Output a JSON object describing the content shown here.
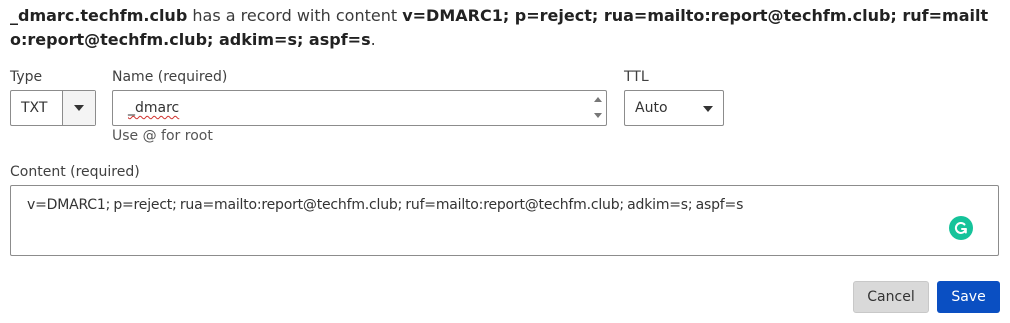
{
  "summary": {
    "record_name": "_dmarc.techfm.club",
    "middle_text": " has a record with content ",
    "record_content": "v=DMARC1; p=reject; rua=mailto:report@techfm.club; ruf=mailto:report@techfm.club; adkim=s; aspf=s",
    "end_punct": "."
  },
  "form": {
    "type_label": "Type",
    "type_value": "TXT",
    "name_label": "Name (required)",
    "name_value": "_dmarc",
    "name_helper": "Use @ for root",
    "ttl_label": "TTL",
    "ttl_value": "Auto",
    "content_label": "Content (required)",
    "content_value": "v=DMARC1; p=reject; rua=mailto:report@techfm.club; ruf=mailto:report@techfm.club; adkim=s; aspf=s"
  },
  "buttons": {
    "cancel": "Cancel",
    "save": "Save"
  },
  "icons": {
    "type_dropdown": "chevron-down-icon",
    "ttl_dropdown": "chevron-down-icon",
    "grammarly": "grammarly-icon"
  },
  "colors": {
    "primary": "#0a4fc2",
    "grammarly": "#15c39a"
  }
}
